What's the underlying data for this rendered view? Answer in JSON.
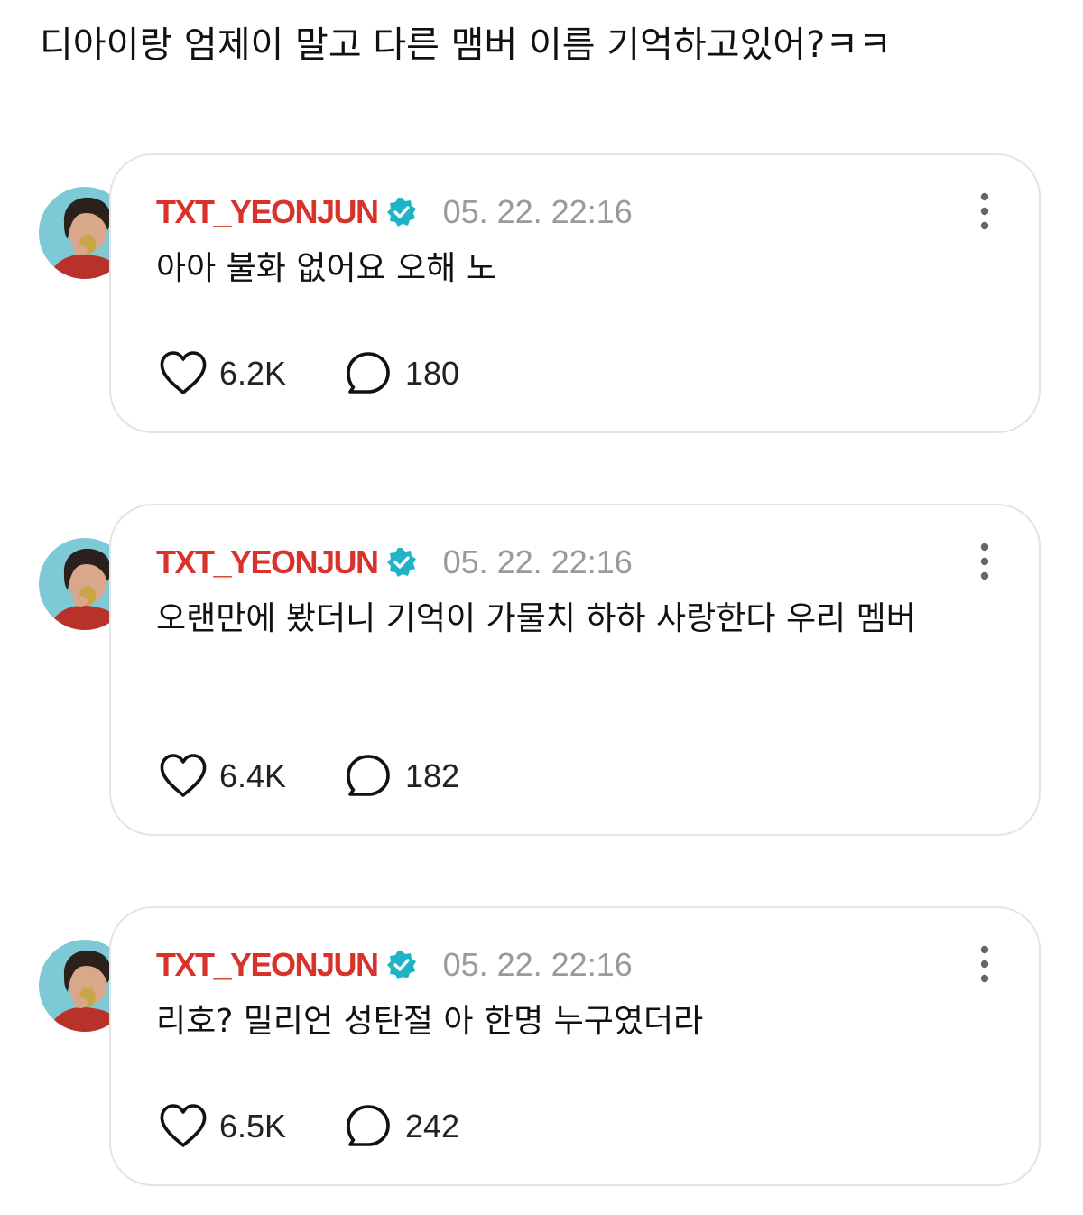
{
  "question": "디아이랑 엄제이 말고 다른 맴버 이름 기억하고있어?ㅋㅋ",
  "accent": {
    "username": "#d8322b",
    "verified": "#1fb3c7",
    "time": "#9a9a9a"
  },
  "comments": [
    {
      "username": "TXT_YEONJUN",
      "time": "05. 22. 22:16",
      "text": "아아 불화 없어요 오해 노",
      "likes": "6.2K",
      "replies": "180"
    },
    {
      "username": "TXT_YEONJUN",
      "time": "05. 22. 22:16",
      "text": "오랜만에 봤더니 기억이 가물치 하하 사랑한다 우리 멤버",
      "likes": "6.4K",
      "replies": "182"
    },
    {
      "username": "TXT_YEONJUN",
      "time": "05. 22. 22:16",
      "text": "리호? 밀리언 성탄절 아 한명 누구였더라",
      "likes": "6.5K",
      "replies": "242"
    }
  ],
  "icons": {
    "verified": "verified-badge-icon",
    "more": "more-vertical-icon",
    "like": "heart-icon",
    "reply": "speech-bubble-icon"
  }
}
